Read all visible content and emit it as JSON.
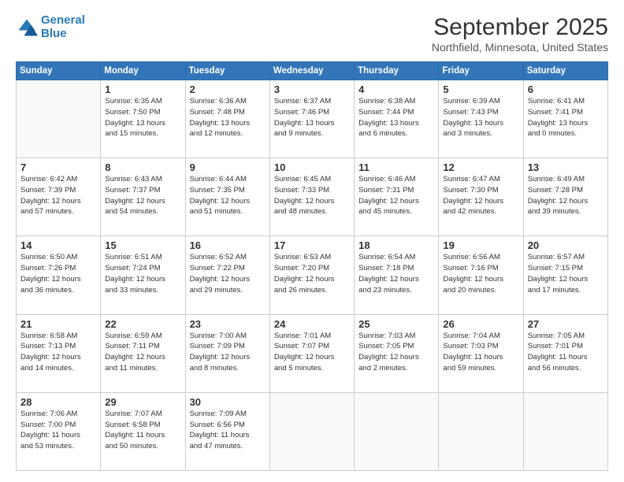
{
  "header": {
    "logo_line1": "General",
    "logo_line2": "Blue",
    "month": "September 2025",
    "location": "Northfield, Minnesota, United States"
  },
  "weekdays": [
    "Sunday",
    "Monday",
    "Tuesday",
    "Wednesday",
    "Thursday",
    "Friday",
    "Saturday"
  ],
  "weeks": [
    [
      {
        "day": "",
        "info": ""
      },
      {
        "day": "1",
        "info": "Sunrise: 6:35 AM\nSunset: 7:50 PM\nDaylight: 13 hours\nand 15 minutes."
      },
      {
        "day": "2",
        "info": "Sunrise: 6:36 AM\nSunset: 7:48 PM\nDaylight: 13 hours\nand 12 minutes."
      },
      {
        "day": "3",
        "info": "Sunrise: 6:37 AM\nSunset: 7:46 PM\nDaylight: 13 hours\nand 9 minutes."
      },
      {
        "day": "4",
        "info": "Sunrise: 6:38 AM\nSunset: 7:44 PM\nDaylight: 13 hours\nand 6 minutes."
      },
      {
        "day": "5",
        "info": "Sunrise: 6:39 AM\nSunset: 7:43 PM\nDaylight: 13 hours\nand 3 minutes."
      },
      {
        "day": "6",
        "info": "Sunrise: 6:41 AM\nSunset: 7:41 PM\nDaylight: 13 hours\nand 0 minutes."
      }
    ],
    [
      {
        "day": "7",
        "info": "Sunrise: 6:42 AM\nSunset: 7:39 PM\nDaylight: 12 hours\nand 57 minutes."
      },
      {
        "day": "8",
        "info": "Sunrise: 6:43 AM\nSunset: 7:37 PM\nDaylight: 12 hours\nand 54 minutes."
      },
      {
        "day": "9",
        "info": "Sunrise: 6:44 AM\nSunset: 7:35 PM\nDaylight: 12 hours\nand 51 minutes."
      },
      {
        "day": "10",
        "info": "Sunrise: 6:45 AM\nSunset: 7:33 PM\nDaylight: 12 hours\nand 48 minutes."
      },
      {
        "day": "11",
        "info": "Sunrise: 6:46 AM\nSunset: 7:31 PM\nDaylight: 12 hours\nand 45 minutes."
      },
      {
        "day": "12",
        "info": "Sunrise: 6:47 AM\nSunset: 7:30 PM\nDaylight: 12 hours\nand 42 minutes."
      },
      {
        "day": "13",
        "info": "Sunrise: 6:49 AM\nSunset: 7:28 PM\nDaylight: 12 hours\nand 39 minutes."
      }
    ],
    [
      {
        "day": "14",
        "info": "Sunrise: 6:50 AM\nSunset: 7:26 PM\nDaylight: 12 hours\nand 36 minutes."
      },
      {
        "day": "15",
        "info": "Sunrise: 6:51 AM\nSunset: 7:24 PM\nDaylight: 12 hours\nand 33 minutes."
      },
      {
        "day": "16",
        "info": "Sunrise: 6:52 AM\nSunset: 7:22 PM\nDaylight: 12 hours\nand 29 minutes."
      },
      {
        "day": "17",
        "info": "Sunrise: 6:53 AM\nSunset: 7:20 PM\nDaylight: 12 hours\nand 26 minutes."
      },
      {
        "day": "18",
        "info": "Sunrise: 6:54 AM\nSunset: 7:18 PM\nDaylight: 12 hours\nand 23 minutes."
      },
      {
        "day": "19",
        "info": "Sunrise: 6:56 AM\nSunset: 7:16 PM\nDaylight: 12 hours\nand 20 minutes."
      },
      {
        "day": "20",
        "info": "Sunrise: 6:57 AM\nSunset: 7:15 PM\nDaylight: 12 hours\nand 17 minutes."
      }
    ],
    [
      {
        "day": "21",
        "info": "Sunrise: 6:58 AM\nSunset: 7:13 PM\nDaylight: 12 hours\nand 14 minutes."
      },
      {
        "day": "22",
        "info": "Sunrise: 6:59 AM\nSunset: 7:11 PM\nDaylight: 12 hours\nand 11 minutes."
      },
      {
        "day": "23",
        "info": "Sunrise: 7:00 AM\nSunset: 7:09 PM\nDaylight: 12 hours\nand 8 minutes."
      },
      {
        "day": "24",
        "info": "Sunrise: 7:01 AM\nSunset: 7:07 PM\nDaylight: 12 hours\nand 5 minutes."
      },
      {
        "day": "25",
        "info": "Sunrise: 7:03 AM\nSunset: 7:05 PM\nDaylight: 12 hours\nand 2 minutes."
      },
      {
        "day": "26",
        "info": "Sunrise: 7:04 AM\nSunset: 7:03 PM\nDaylight: 11 hours\nand 59 minutes."
      },
      {
        "day": "27",
        "info": "Sunrise: 7:05 AM\nSunset: 7:01 PM\nDaylight: 11 hours\nand 56 minutes."
      }
    ],
    [
      {
        "day": "28",
        "info": "Sunrise: 7:06 AM\nSunset: 7:00 PM\nDaylight: 11 hours\nand 53 minutes."
      },
      {
        "day": "29",
        "info": "Sunrise: 7:07 AM\nSunset: 6:58 PM\nDaylight: 11 hours\nand 50 minutes."
      },
      {
        "day": "30",
        "info": "Sunrise: 7:09 AM\nSunset: 6:56 PM\nDaylight: 11 hours\nand 47 minutes."
      },
      {
        "day": "",
        "info": ""
      },
      {
        "day": "",
        "info": ""
      },
      {
        "day": "",
        "info": ""
      },
      {
        "day": "",
        "info": ""
      }
    ]
  ]
}
